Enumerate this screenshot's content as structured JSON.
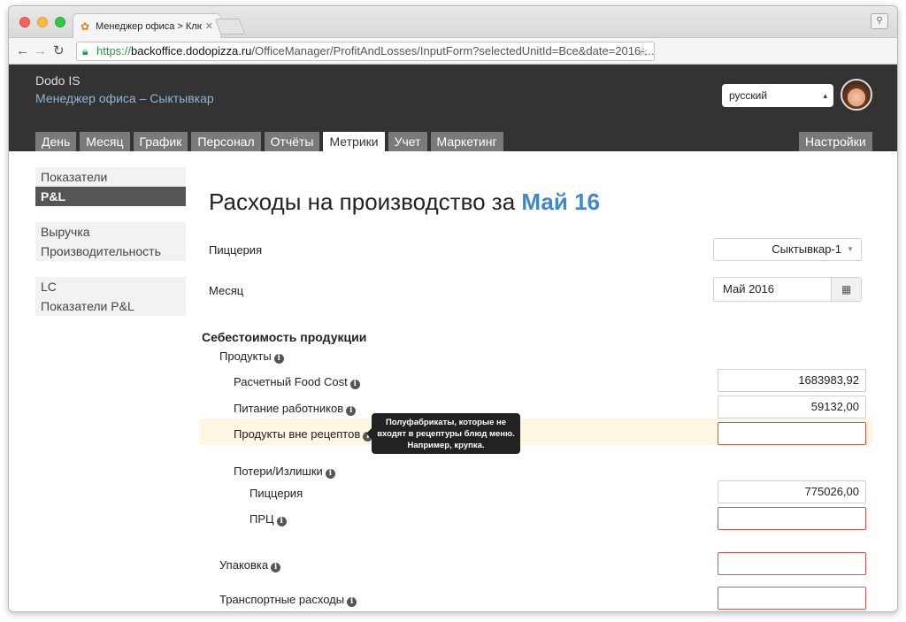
{
  "browser": {
    "tab_title": "Менеджер офиса > Ключе",
    "url_scheme": "https://",
    "url_domain": "backoffice.dodopizza.ru",
    "url_path": "/OfficeManager/ProfitAndLosses/InputForm?selectedUnitId=Bce&date=2016-..."
  },
  "header": {
    "brand": "Dodo IS",
    "subtitle": "Менеджер офиса – Сыктывкар",
    "language": "русский"
  },
  "nav": {
    "tabs": [
      {
        "label": "День"
      },
      {
        "label": "Месяц"
      },
      {
        "label": "График"
      },
      {
        "label": "Персонал"
      },
      {
        "label": "Отчёты"
      },
      {
        "label": "Метрики"
      },
      {
        "label": "Учет"
      },
      {
        "label": "Маркетинг"
      }
    ],
    "active_tab": "Метрики",
    "settings": "Настройки"
  },
  "sidebar": {
    "groups": [
      {
        "items": [
          {
            "label": "Показатели"
          },
          {
            "label": "P&L"
          }
        ]
      },
      {
        "items": [
          {
            "label": "Выручка"
          },
          {
            "label": "Производительность"
          }
        ]
      },
      {
        "items": [
          {
            "label": "LC"
          },
          {
            "label": "Показатели P&L"
          }
        ]
      }
    ],
    "active_item": "P&L"
  },
  "page": {
    "title_prefix": "Расходы на производство за",
    "title_period": "Май 16",
    "pizzeria_label": "Пиццерия",
    "pizzeria_value": "Сыктывкар-1",
    "month_label": "Месяц",
    "month_value": "Май 2016",
    "section_title": "Себестоимость продукции"
  },
  "fields": {
    "products": "Продукты",
    "food_cost": {
      "label": "Расчетный Food Cost",
      "value": "1683983,92"
    },
    "staff_meals": {
      "label": "Питание работников",
      "value": "59132,00"
    },
    "off_recipe": {
      "label": "Продукты вне рецептов",
      "value": ""
    },
    "losses": "Потери/Излишки",
    "pizzeria_loss": {
      "label": "Пиццерия",
      "value": "775026,00"
    },
    "prc": {
      "label": "ПРЦ",
      "value": ""
    },
    "packaging": {
      "label": "Упаковка",
      "value": ""
    },
    "transport": {
      "label": "Транспортные расходы",
      "value": ""
    }
  },
  "tooltip": {
    "line1": "Полуфабрикаты, которые не",
    "line2": "входят в рецептуры блюд меню.",
    "line3": "Например, крупка."
  },
  "colors": {
    "header_bg": "#333333",
    "accent": "#3f88cc",
    "error_border": "#d9534f",
    "highlight_row": "#fdf6e3"
  }
}
